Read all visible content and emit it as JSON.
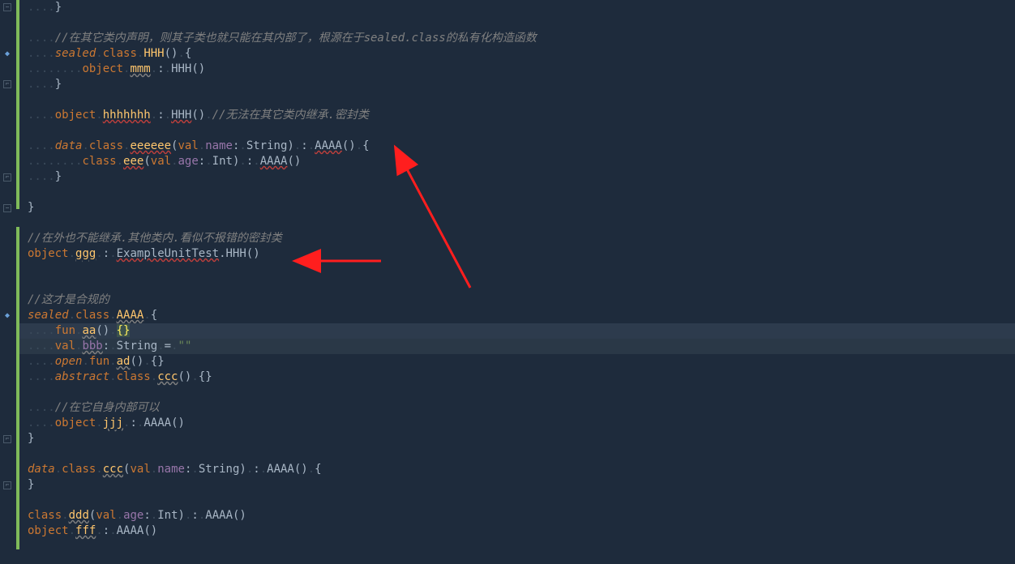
{
  "lines": {
    "l1_close": "}",
    "l3_comment": "//在其它类内声明，则其子类也就只能在其内部了，根源在于sealed.class的私有化构造函数",
    "l4_sealed": "sealed",
    "l4_class": "class",
    "l4_name": "HHH",
    "l5_object": "object",
    "l5_name": "mmm",
    "l5_ext": "HHH",
    "l6_close": "}",
    "l8_object": "object",
    "l8_name": "hhhhhhh",
    "l8_ext": "HHH",
    "l8_comment": "//无法在其它类内继承.密封类",
    "l10_data": "data",
    "l10_class": "class",
    "l10_name": "eeeeee",
    "l10_val": "val",
    "l10_param": "name",
    "l10_ptype": "String",
    "l10_ext": "AAAA",
    "l11_class": "class",
    "l11_name": "eee",
    "l11_val": "val",
    "l11_param": "age",
    "l11_ptype": "Int",
    "l11_ext": "AAAA",
    "l12_close": "}",
    "l14_close": "}",
    "l16_comment": "//在外也不能继承.其他类内.看似不报错的密封类",
    "l17_object": "object",
    "l17_name": "ggg",
    "l17_qual": "ExampleUnitTest",
    "l17_ext": "HHH",
    "l19_comment": "//这才是合规的",
    "l20_sealed": "sealed",
    "l20_class": "class",
    "l20_name": "AAAA",
    "l21_fun": "fun",
    "l21_name": "aa",
    "l22_val": "val",
    "l22_name": "bbb",
    "l22_type": "String",
    "l22_value": "\"\"",
    "l23_open": "open",
    "l23_fun": "fun",
    "l23_name": "ad",
    "l24_abstract": "abstract",
    "l24_class": "class",
    "l24_name": "ccc",
    "l26_comment": "//在它自身内部可以",
    "l27_object": "object",
    "l27_name": "jjj",
    "l27_ext": "AAAA",
    "l28_close": "}",
    "l30_data": "data",
    "l30_class": "class",
    "l30_name": "ccc",
    "l30_val": "val",
    "l30_param": "name",
    "l30_ptype": "String",
    "l30_ext": "AAAA",
    "l31_close": "}",
    "l33_class": "class",
    "l33_name": "ddd",
    "l33_val": "val",
    "l33_param": "age",
    "l33_ptype": "Int",
    "l33_ext": "AAAA",
    "l34_object": "object",
    "l34_name": "fff",
    "l34_ext": "AAAA"
  },
  "dots4": "....",
  "dots8": "........",
  "icons": {
    "kotlin": "◆",
    "fold_minus": "−",
    "fold_end": "⌐"
  }
}
